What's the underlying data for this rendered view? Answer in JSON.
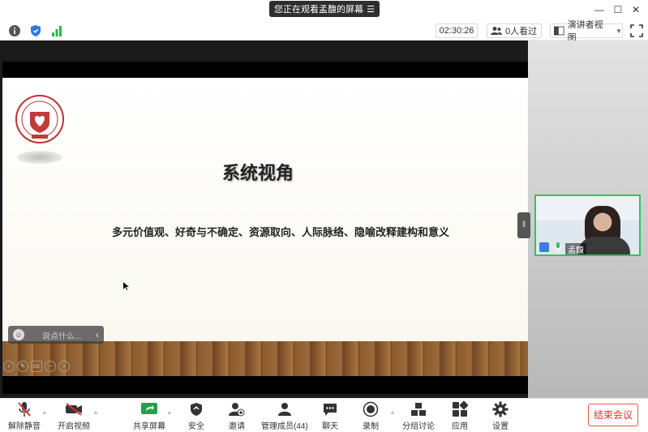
{
  "window": {
    "share_banner": "您正在观看孟馥的屏幕"
  },
  "topbar": {
    "timer": "02:30:26",
    "viewers": "0人看过",
    "presenter_view": "演讲者视图"
  },
  "slide": {
    "title": "系统视角",
    "subtitle": "多元价值观、好奇与不确定、资源取向、人际脉络、隐喻改释建构和意义"
  },
  "chat": {
    "placeholder": "说点什么..."
  },
  "participant": {
    "name": "孟馥"
  },
  "toolbar": {
    "unmute": "解除静音",
    "start_video": "开启视频",
    "share_screen": "共享屏幕",
    "security": "安全",
    "invite": "邀请",
    "manage_members": "管理成员(44)",
    "chat": "聊天",
    "record": "录制",
    "breakout": "分组讨论",
    "apps": "应用",
    "settings": "设置",
    "end_meeting": "结束会议"
  },
  "colors": {
    "accent_green": "#31c45c",
    "end_red": "#e03030",
    "stage_black": "#1b1b1b"
  }
}
